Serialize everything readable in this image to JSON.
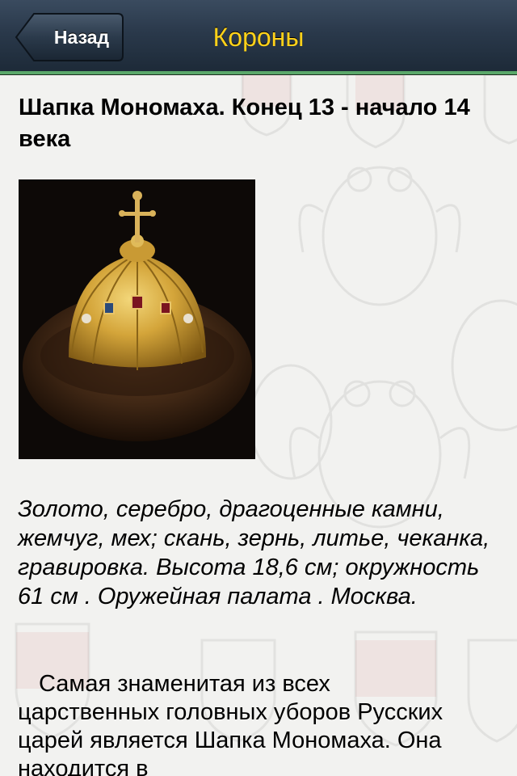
{
  "navbar": {
    "back_label": "Назад",
    "title": "Короны"
  },
  "article": {
    "title": "Шапка Мономаха. Конец 13 - начало 14 века",
    "image_icon": "crown-photo",
    "materials": "Золото, серебро, драгоценные камни, жемчуг, мех; скань, зернь, литье, чеканка, гравировка. Высота 18,6 см; окружность 61 см . Оружейная палата . Москва.",
    "body": "Самая знаменитая из всех царственных головных уборов Русских царей является Шапка Мономаха. Она находится в"
  },
  "colors": {
    "nav_title": "#ffd21a",
    "nav_accent_line": "#5aa86a",
    "nav_background": "#2a394b"
  }
}
